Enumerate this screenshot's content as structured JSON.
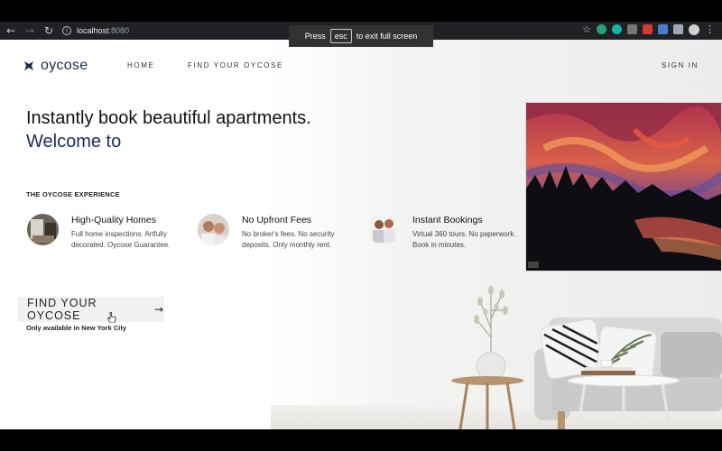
{
  "browser": {
    "url_host": "localhost",
    "url_port": ":8080",
    "fullscreen_toast": {
      "prefix": "Press",
      "key": "esc",
      "suffix": "to exit full screen"
    },
    "icons": [
      "back-icon",
      "forward-icon",
      "reload-icon",
      "info-icon",
      "star-icon",
      "extension-icon",
      "profile-icon",
      "menu-icon"
    ]
  },
  "nav": {
    "brand": "oycose",
    "home": "HOME",
    "find": "FIND YOUR OYCOSE",
    "signin": "SIGN IN"
  },
  "hero": {
    "headline": "Instantly book beautiful apartments.",
    "subline": "Welcome to"
  },
  "experience": {
    "title": "THE OYCOSE EXPERIENCE",
    "features": [
      {
        "title": "High-Quality Homes",
        "desc": "Full home inspections. Artfully decorated. Oycose Guarantee."
      },
      {
        "title": "No Upfront Fees",
        "desc": "No broker's fees. No security deposits. Only monthly rent."
      },
      {
        "title": "Instant Bookings",
        "desc": "Virtual 360 tours. No paperwork. Book in minutes."
      }
    ]
  },
  "cta": {
    "label": "FIND YOUR OYCOSE",
    "note": "Only available in New York City"
  },
  "colors": {
    "brand_navy": "#1d2a5a",
    "chrome_bg": "#202124",
    "page_bg": "#ffffff"
  }
}
